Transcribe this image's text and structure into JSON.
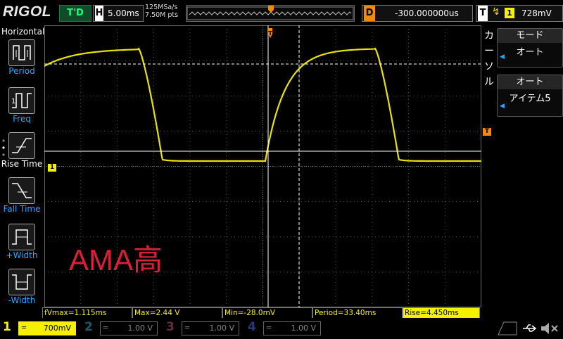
{
  "header": {
    "logo": "RIGOL",
    "trigger_status": "T'D",
    "horizontal_label": "H",
    "timebase": "5.00ms",
    "sample_rate": "125MSa/s",
    "memory_depth": "7.50M pts",
    "delay_label": "D",
    "delay": "-300.000000us",
    "trigger_label": "T",
    "trigger_slope": "↯",
    "trigger_source": "1",
    "trigger_level": "728mV"
  },
  "left_menu": {
    "title": "Horizontal",
    "items": [
      {
        "label": "Period",
        "icon": "period-icon"
      },
      {
        "label": "Freq",
        "icon": "frequency-icon"
      },
      {
        "label": "Rise Time",
        "icon": "rise-time-icon"
      },
      {
        "label": "Fall Time",
        "icon": "fall-time-icon"
      },
      {
        "label": "+Width",
        "icon": "positive-width-icon"
      },
      {
        "label": "-Width",
        "icon": "negative-width-icon"
      }
    ]
  },
  "right_menu": {
    "title": "カーソル",
    "mode_header": "モード",
    "mode_value": "オート",
    "item_header": "オート",
    "item_value": "アイテム5"
  },
  "screen": {
    "watermark": "AMA高",
    "trigger_marker": "T",
    "ch1_marker": "1",
    "trigger_level_marker": "T"
  },
  "measurements": [
    {
      "text": "fVmax=1.115ms"
    },
    {
      "text": "Max=2.44 V"
    },
    {
      "text": "Min=-28.0mV"
    },
    {
      "text": "Period=33.40ms"
    },
    {
      "text": "Rise=4.450ms"
    }
  ],
  "channels": [
    {
      "number": "1",
      "coupling": "═",
      "scale": "700mV",
      "color": "#f4f000"
    },
    {
      "number": "2",
      "coupling": "═",
      "scale": "1.00 V",
      "color": "#00c8ff"
    },
    {
      "number": "3",
      "coupling": "═",
      "scale": "1.00 V",
      "color": "#ff3ca0"
    },
    {
      "number": "4",
      "coupling": "═",
      "scale": "1.00 V",
      "color": "#3c64ff"
    }
  ],
  "colors": {
    "ch1": "#f4f000",
    "accent_blue": "#2aa8ff",
    "trigger_orange": "#f48a00",
    "trigger_green": "#1fff7a"
  }
}
